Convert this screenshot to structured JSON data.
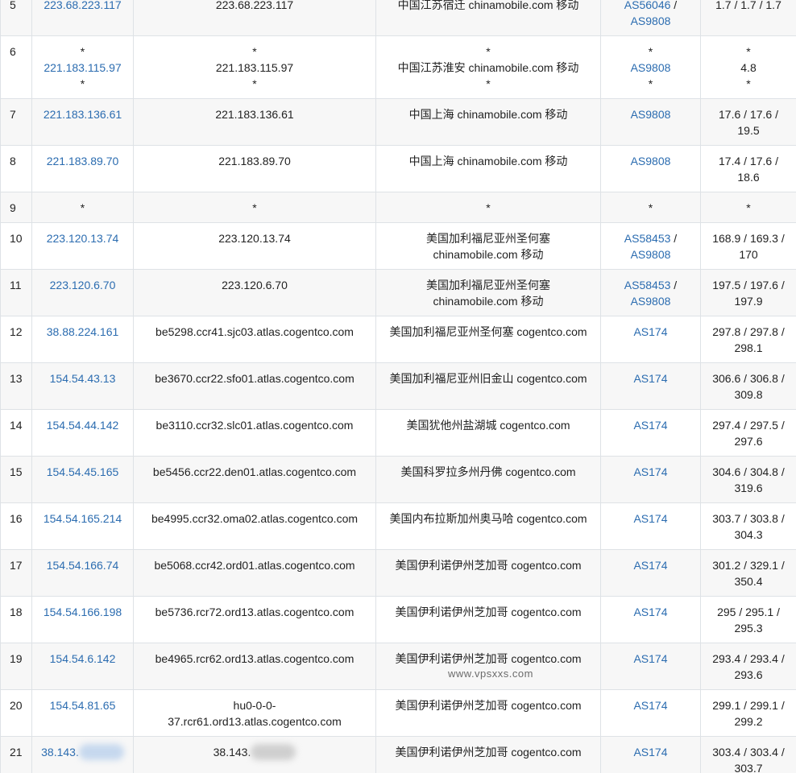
{
  "watermark": "www.vpsxxs.com",
  "rows": [
    {
      "hop": "5",
      "ip": [
        "223.68.223.117"
      ],
      "host": [
        "223.68.223.117"
      ],
      "loc": [
        "中国江苏宿迁 chinamobile.com 移动"
      ],
      "asn": [
        "AS56046",
        "AS9808"
      ],
      "lat": [
        "1.7 / 1.7 / 1.7"
      ]
    },
    {
      "hop": "6",
      "ip": [
        "*",
        "221.183.115.97",
        "*"
      ],
      "host": [
        "*",
        "221.183.115.97",
        "*"
      ],
      "loc": [
        "*",
        "中国江苏淮安 chinamobile.com 移动",
        "*"
      ],
      "asn": [
        "*",
        "AS9808",
        "*"
      ],
      "lat": [
        "*",
        "4.8",
        "*"
      ]
    },
    {
      "hop": "7",
      "ip": [
        "221.183.136.61"
      ],
      "host": [
        "221.183.136.61"
      ],
      "loc": [
        "中国上海 chinamobile.com 移动"
      ],
      "asn": [
        "AS9808"
      ],
      "lat": [
        "17.6 / 17.6 /",
        "19.5"
      ]
    },
    {
      "hop": "8",
      "ip": [
        "221.183.89.70"
      ],
      "host": [
        "221.183.89.70"
      ],
      "loc": [
        "中国上海 chinamobile.com 移动"
      ],
      "asn": [
        "AS9808"
      ],
      "lat": [
        "17.4 / 17.6 /",
        "18.6"
      ]
    },
    {
      "hop": "9",
      "ip": [
        "*"
      ],
      "host": [
        "*"
      ],
      "loc": [
        "*"
      ],
      "asn": [
        "*"
      ],
      "lat": [
        "*"
      ]
    },
    {
      "hop": "10",
      "ip": [
        "223.120.13.74"
      ],
      "host": [
        "223.120.13.74"
      ],
      "loc": [
        "美国加利福尼亚州圣何塞",
        "chinamobile.com 移动"
      ],
      "asn": [
        "AS58453",
        "AS9808"
      ],
      "lat": [
        "168.9 / 169.3 /",
        "170"
      ]
    },
    {
      "hop": "11",
      "ip": [
        "223.120.6.70"
      ],
      "host": [
        "223.120.6.70"
      ],
      "loc": [
        "美国加利福尼亚州圣何塞",
        "chinamobile.com 移动"
      ],
      "asn": [
        "AS58453",
        "AS9808"
      ],
      "lat": [
        "197.5 / 197.6 /",
        "197.9"
      ]
    },
    {
      "hop": "12",
      "ip": [
        "38.88.224.161"
      ],
      "host": [
        "be5298.ccr41.sjc03.atlas.cogentco.com"
      ],
      "loc": [
        "美国加利福尼亚州圣何塞 cogentco.com"
      ],
      "asn": [
        "AS174"
      ],
      "lat": [
        "297.8 / 297.8 /",
        "298.1"
      ]
    },
    {
      "hop": "13",
      "ip": [
        "154.54.43.13"
      ],
      "host": [
        "be3670.ccr22.sfo01.atlas.cogentco.com"
      ],
      "loc": [
        "美国加利福尼亚州旧金山 cogentco.com"
      ],
      "asn": [
        "AS174"
      ],
      "lat": [
        "306.6 / 306.8 /",
        "309.8"
      ]
    },
    {
      "hop": "14",
      "ip": [
        "154.54.44.142"
      ],
      "host": [
        "be3110.ccr32.slc01.atlas.cogentco.com"
      ],
      "loc": [
        "美国犹他州盐湖城 cogentco.com"
      ],
      "asn": [
        "AS174"
      ],
      "lat": [
        "297.4 / 297.5 /",
        "297.6"
      ]
    },
    {
      "hop": "15",
      "ip": [
        "154.54.45.165"
      ],
      "host": [
        "be5456.ccr22.den01.atlas.cogentco.com"
      ],
      "loc": [
        "美国科罗拉多州丹佛 cogentco.com"
      ],
      "asn": [
        "AS174"
      ],
      "lat": [
        "304.6 / 304.8 /",
        "319.6"
      ]
    },
    {
      "hop": "16",
      "ip": [
        "154.54.165.214"
      ],
      "host": [
        "be4995.ccr32.oma02.atlas.cogentco.com"
      ],
      "loc": [
        "美国内布拉斯加州奥马哈 cogentco.com"
      ],
      "asn": [
        "AS174"
      ],
      "lat": [
        "303.7 / 303.8 /",
        "304.3"
      ]
    },
    {
      "hop": "17",
      "ip": [
        "154.54.166.74"
      ],
      "host": [
        "be5068.ccr42.ord01.atlas.cogentco.com"
      ],
      "loc": [
        "美国伊利诺伊州芝加哥 cogentco.com"
      ],
      "asn": [
        "AS174"
      ],
      "lat": [
        "301.2 / 329.1 /",
        "350.4"
      ]
    },
    {
      "hop": "18",
      "ip": [
        "154.54.166.198"
      ],
      "host": [
        "be5736.rcr72.ord13.atlas.cogentco.com"
      ],
      "loc": [
        "美国伊利诺伊州芝加哥 cogentco.com"
      ],
      "asn": [
        "AS174"
      ],
      "lat": [
        "295 / 295.1 /",
        "295.3"
      ]
    },
    {
      "hop": "19",
      "ip": [
        "154.54.6.142"
      ],
      "host": [
        "be4965.rcr62.ord13.atlas.cogentco.com"
      ],
      "loc": [
        "美国伊利诺伊州芝加哥 cogentco.com"
      ],
      "asn": [
        "AS174"
      ],
      "lat": [
        "293.4 / 293.4 /",
        "293.6"
      ]
    },
    {
      "hop": "20",
      "ip": [
        "154.54.81.65"
      ],
      "host": [
        "hu0-0-0-",
        "37.rcr61.ord13.atlas.cogentco.com"
      ],
      "loc": [
        "美国伊利诺伊州芝加哥 cogentco.com"
      ],
      "asn": [
        "AS174"
      ],
      "lat": [
        "299.1 / 299.1 /",
        "299.2"
      ]
    },
    {
      "hop": "21",
      "ip": [
        "38.143."
      ],
      "host": [
        "38.143."
      ],
      "loc": [
        "美国伊利诺伊州芝加哥 cogentco.com"
      ],
      "asn": [
        "AS174"
      ],
      "lat": [
        "303.4 / 303.4 /",
        "303.7"
      ],
      "redacted": true
    }
  ]
}
